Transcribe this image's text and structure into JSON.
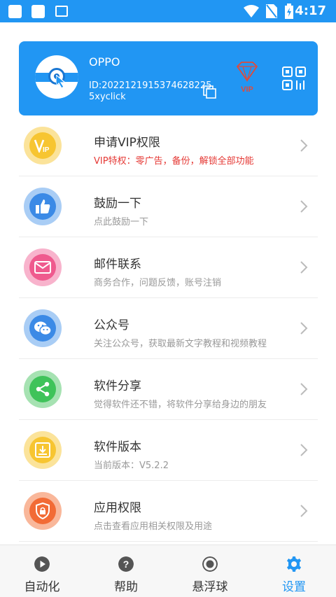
{
  "status_bar": {
    "time": "4:17"
  },
  "profile": {
    "name": "OPPO",
    "id_text": "ID:20221219153746282255xyclick"
  },
  "list": [
    {
      "title": "申请VIP权限",
      "subtitle": "VIP特权：零广告，备份，解锁全部功能",
      "icon": "vip-icon",
      "color": "#f7c531"
    },
    {
      "title": "鼓励一下",
      "subtitle": "点此鼓励一下",
      "icon": "thumbs-up-icon",
      "color": "#3b8ae6"
    },
    {
      "title": "邮件联系",
      "subtitle": "商务合作，问题反馈，账号注销",
      "icon": "mail-icon",
      "color": "#ef5a8e"
    },
    {
      "title": "公众号",
      "subtitle": "关注公众号，获取最新文字教程和视频教程",
      "icon": "wechat-icon",
      "color": "#3b8ae6"
    },
    {
      "title": "软件分享",
      "subtitle": "觉得软件还不错，将软件分享给身边的朋友",
      "icon": "share-icon",
      "color": "#3fc35a"
    },
    {
      "title": "软件版本",
      "subtitle": "当前版本：V5.2.2",
      "icon": "download-icon",
      "color": "#f7c531"
    },
    {
      "title": "应用权限",
      "subtitle": "点击查看应用相关权限及用途",
      "icon": "shield-lock-icon",
      "color": "#f26b35"
    }
  ],
  "tabs": [
    {
      "label": "自动化",
      "icon": "play-icon"
    },
    {
      "label": "帮助",
      "icon": "help-icon"
    },
    {
      "label": "悬浮球",
      "icon": "record-icon"
    },
    {
      "label": "设置",
      "icon": "gear-icon"
    }
  ],
  "colors": {
    "accent": "#2196f3",
    "vip_red": "#e53935"
  }
}
